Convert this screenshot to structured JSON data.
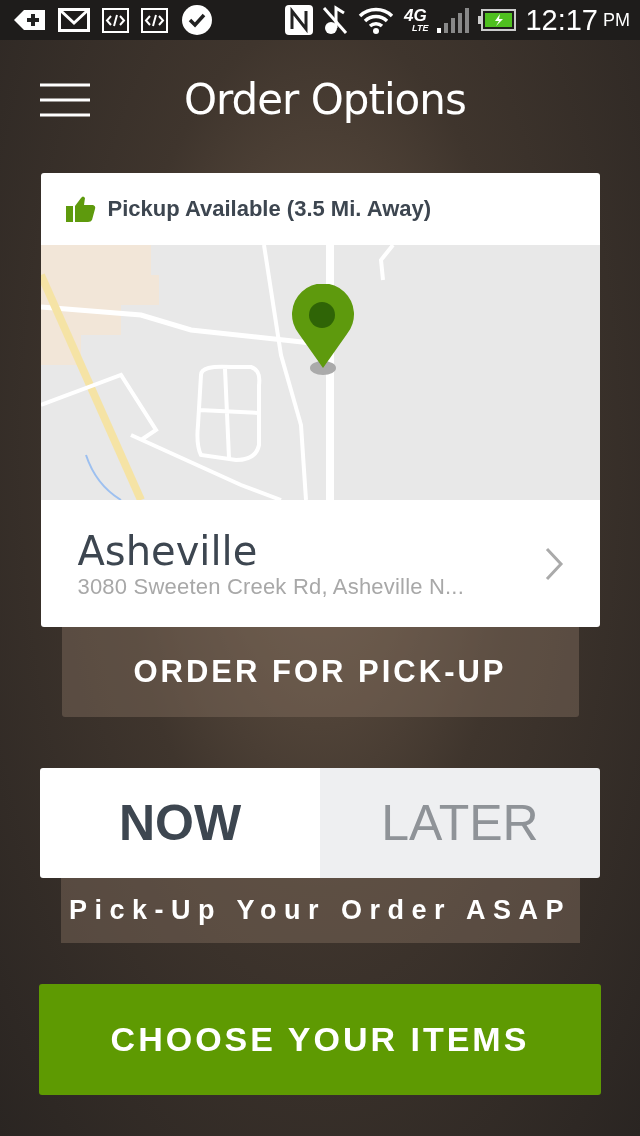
{
  "status_bar": {
    "network": "4G",
    "network_sub": "LTE",
    "time": "12:17",
    "period": "PM"
  },
  "header": {
    "title": "Order Options"
  },
  "location_card": {
    "availability": "Pickup Available (3.5 Mi. Away)",
    "store_name": "Asheville",
    "address": "3080 Sweeten Creek Rd, Asheville N..."
  },
  "order_type_button": "ORDER FOR PICK-UP",
  "timing_tabs": [
    {
      "label": "NOW",
      "selected": true
    },
    {
      "label": "LATER",
      "selected": false
    }
  ],
  "timing_note": "Pick-Up Your Order ASAP",
  "primary_button": "CHOOSE YOUR ITEMS"
}
